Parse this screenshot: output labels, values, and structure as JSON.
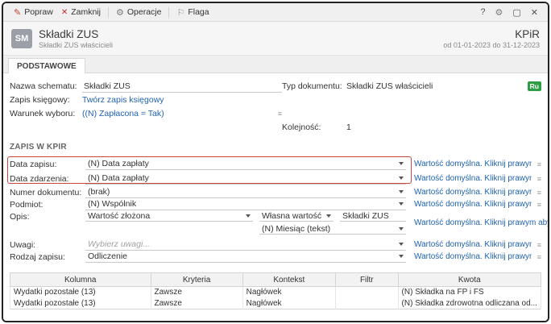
{
  "titlebar": {
    "popraw": "Popraw",
    "zamknij": "Zamknij",
    "operacje": "Operacje",
    "flaga": "Flaga",
    "help": "?"
  },
  "header": {
    "badge": "SM",
    "title": "Składki ZUS",
    "subtitle": "Składki ZUS właścicieli",
    "doc_type": "KPiR",
    "period": "od 01-01-2023 do 31-12-2023"
  },
  "tabs": {
    "podstawowe": "PODSTAWOWE"
  },
  "general": {
    "nazwa_label": "Nazwa schematu:",
    "nazwa_value": "Składki ZUS",
    "typ_label": "Typ dokumentu:",
    "typ_value": "Składki ZUS właścicieli",
    "typ_badge": "Ru",
    "zapis_label": "Zapis księgowy:",
    "zapis_value": "Twórz zapis księgowy",
    "warunek_label": "Warunek wyboru:",
    "warunek_value": "((N) Zapłacona = Tak)",
    "kolejnosc_label": "Kolejność:",
    "kolejnosc_value": "1"
  },
  "kpir": {
    "section_title": "ZAPIS W KPIR",
    "default_hint": "Wartość domyślna. Kliknij prawym aby zmienić.",
    "data_zapisu_label": "Data zapisu:",
    "data_zapisu_value": "(N) Data zapłaty",
    "data_zdarzenia_label": "Data zdarzenia:",
    "data_zdarzenia_value": "(N) Data zapłaty",
    "numer_label": "Numer dokumentu:",
    "numer_value": "(brak)",
    "podmiot_label": "Podmiot:",
    "podmiot_value": "(N) Wspólnik",
    "opis_label": "Opis:",
    "opis_value1": "Wartość złożona",
    "opis_value2": "Własna wartość",
    "opis_value3": "Składki ZUS",
    "opis_value4": "(N) Miesiąc (tekst)",
    "uwagi_label": "Uwagi:",
    "uwagi_placeholder": "Wybierz uwagi...",
    "rodzaj_label": "Rodzaj zapisu:",
    "rodzaj_value": "Odliczenie"
  },
  "table": {
    "headers": [
      "Kolumna",
      "Kryteria",
      "Kontekst",
      "Filtr",
      "Kwota"
    ],
    "rows": [
      {
        "kolumna": "Wydatki pozostałe (13)",
        "kryteria": "Zawsze",
        "kontekst": "Nagłówek",
        "filtr": "",
        "kwota": "(N) Składka na FP i FS"
      },
      {
        "kolumna": "Wydatki pozostałe (13)",
        "kryteria": "Zawsze",
        "kontekst": "Nagłówek",
        "filtr": "",
        "kwota": "(N) Składka zdrowotna odliczana od..."
      }
    ]
  }
}
